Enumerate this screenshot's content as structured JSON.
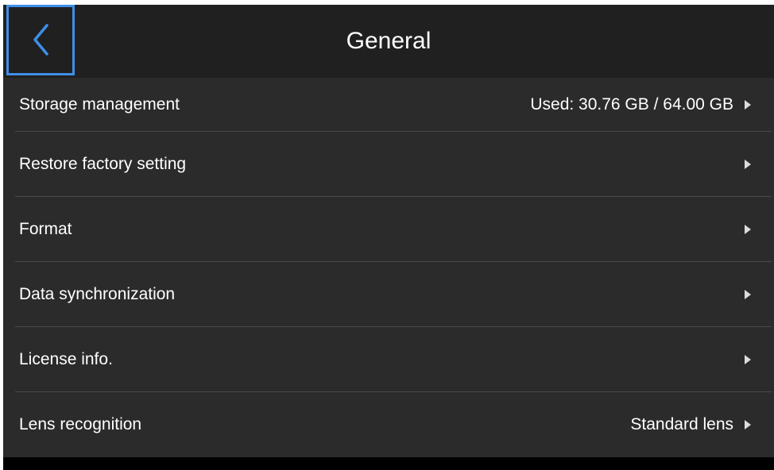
{
  "header": {
    "title": "General",
    "back_icon": "chevron-left-icon",
    "focus_color": "#3f8fe8"
  },
  "settings": {
    "rows": [
      {
        "label": "Storage management",
        "value": "Used: 30.76 GB / 64.00 GB"
      },
      {
        "label": "Restore factory setting",
        "value": ""
      },
      {
        "label": "Format",
        "value": ""
      },
      {
        "label": "Data synchronization",
        "value": ""
      },
      {
        "label": "License info.",
        "value": ""
      },
      {
        "label": "Lens recognition",
        "value": "Standard lens"
      }
    ],
    "row_icon": "chevron-right-icon"
  },
  "colors": {
    "header_bg": "#202020",
    "list_bg": "#2b2b2b",
    "divider": "#4a4a4a",
    "text": "#ffffff"
  }
}
